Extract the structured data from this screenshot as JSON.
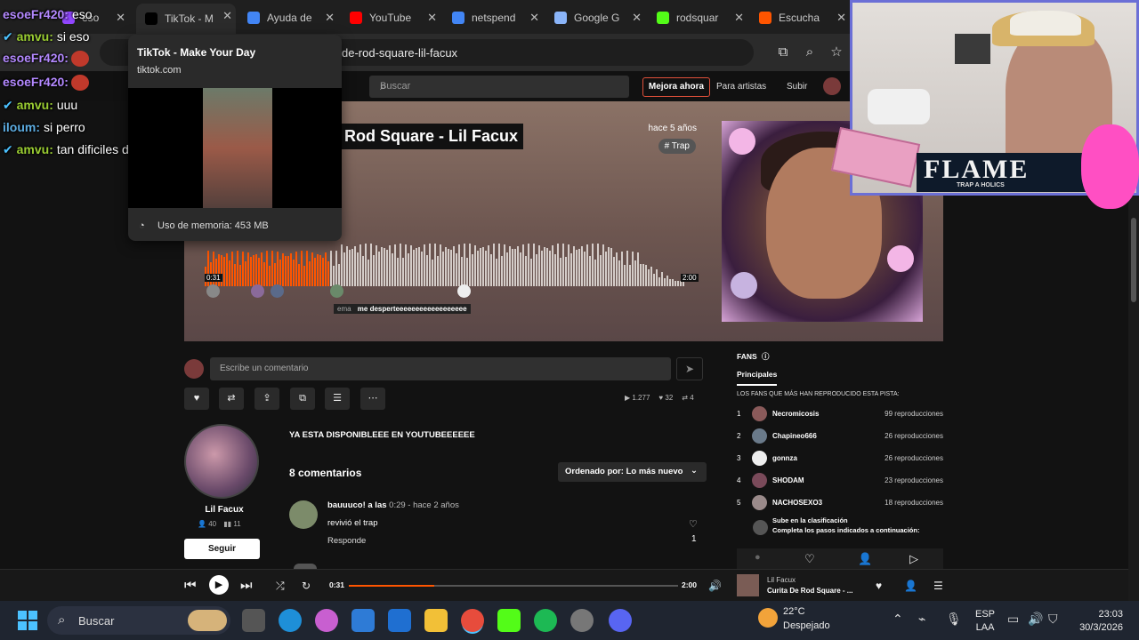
{
  "browser": {
    "tabs": [
      {
        "label": "eso",
        "favicon": "twitch-icon",
        "color": "#9146ff"
      },
      {
        "label": "TikTok - M",
        "favicon": "tiktok-icon",
        "color": "#000000"
      },
      {
        "label": "Ayuda de",
        "favicon": "google-icon",
        "color": "#4285f4"
      },
      {
        "label": "YouTube",
        "favicon": "youtube-icon",
        "color": "#ff0000"
      },
      {
        "label": "netspend",
        "favicon": "google-icon",
        "color": "#4285f4"
      },
      {
        "label": "Google G",
        "favicon": "gemini-icon",
        "color": "#8ab4f8"
      },
      {
        "label": "rodsquar",
        "favicon": "kick-icon",
        "color": "#53fc18"
      },
      {
        "label": "Escucha",
        "favicon": "soundcloud-icon",
        "color": "#ff5500"
      }
    ],
    "url": "de-rod-square-lil-facux"
  },
  "tooltip": {
    "title": "TikTok - Make Your Day",
    "domain": "tiktok.com",
    "memory": "Uso de memoria: 453 MB"
  },
  "chat": [
    {
      "user": "esoeFr420:",
      "text": "eso",
      "color": "#b388ff",
      "badge": false,
      "emote": false
    },
    {
      "user": "amvu:",
      "text": "si eso",
      "color": "#9acd32",
      "badge": true,
      "emote": false
    },
    {
      "user": "esoeFr420:",
      "text": "",
      "color": "#b388ff",
      "badge": false,
      "emote": true
    },
    {
      "user": "esoeFr420:",
      "text": "",
      "color": "#b388ff",
      "badge": false,
      "emote": true
    },
    {
      "user": "amvu:",
      "text": "uuu",
      "color": "#9acd32",
      "badge": true,
      "emote": false
    },
    {
      "user": "iloum:",
      "text": "si perro",
      "color": "#5dade2",
      "badge": false,
      "emote": false
    },
    {
      "user": "amvu:",
      "text": "tan dificiles de ver amigo",
      "color": "#9acd32",
      "badge": true,
      "emote": false
    }
  ],
  "soundcloud": {
    "header": {
      "search_placeholder": "Buscar",
      "upgrade": "Mejora ahora",
      "artists": "Para artistas",
      "upload": "Subir"
    },
    "track": {
      "title": "Rod Square - Lil Facux",
      "ago": "hace 5 años",
      "tag": "# Trap",
      "time_start": "0:31",
      "time_end": "2:00",
      "wave_comment_user": "ema",
      "wave_comment_text": "me desperteeeeeeeeeeeeeeeeee",
      "progress": 0.26,
      "played_color": "#ff5500"
    },
    "comment_placeholder": "Escribe un comentario",
    "stats": {
      "plays": "1.277",
      "likes": "32",
      "reposts": "4"
    },
    "artist": {
      "name": "Lil Facux",
      "followers": "40",
      "tracks": "11",
      "follow": "Seguir"
    },
    "description": "YA ESTA DISPONIBLEEE EN YOUTUBEEEEEE",
    "comments_count": "8 comentarios",
    "sort": "Ordenado por: Lo más nuevo",
    "comment": {
      "user": "bauuuco! a las",
      "time": "0:29",
      "ago": "- hace 2 años",
      "text": "revivió el trap",
      "reply": "Responde",
      "likes": "1"
    },
    "fans": {
      "label": "FANS",
      "tab": "Principales",
      "subtitle": "LOS FANS QUE MÁS HAN REPRODUCIDO ESTA PISTA:",
      "rows": [
        {
          "rank": "1",
          "name": "Necromicosis",
          "plays": "99 reproducciones"
        },
        {
          "rank": "2",
          "name": "Chapineo666",
          "plays": "26 reproducciones"
        },
        {
          "rank": "3",
          "name": "gonnza",
          "plays": "26 reproducciones"
        },
        {
          "rank": "4",
          "name": "SHODAM",
          "plays": "23 reproducciones"
        },
        {
          "rank": "5",
          "name": "NACHOSEXO3",
          "plays": "18 reproducciones"
        }
      ],
      "climb_title": "Sube en la clasificación",
      "climb_text": "Completa los pasos indicados a continuación:"
    }
  },
  "player": {
    "current": "0:31",
    "total": "2:00",
    "artist": "Lil Facux",
    "title": "Curita De Rod Square - ...",
    "progress": 0.26
  },
  "overlay": {
    "flame_text": "FLAME",
    "flame_sub": "TRAP A HOLICS"
  },
  "taskbar": {
    "search": "Buscar",
    "temp": "22°C",
    "weather": "Despejado",
    "lang1": "ESP",
    "lang2": "LAA",
    "time": "23:03",
    "date": "30/3/2026"
  }
}
